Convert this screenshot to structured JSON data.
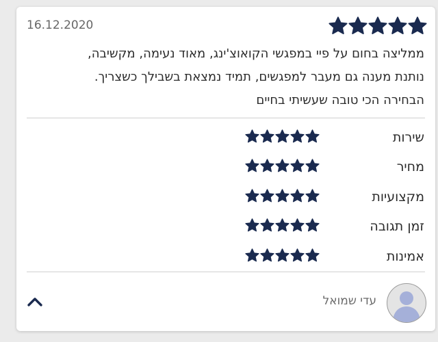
{
  "review": {
    "date": "16.12.2020",
    "overall_rating": 5,
    "overall_max": 5,
    "text_lines": [
      "ממליצה בחום על פיי במפגשי הקואוצ'ינג, מאוד נעימה, מקשיבה,",
      "נותנת מענה גם מעבר למפגשים, תמיד נמצאת בשבילך כשצריך.",
      "הבחירה הכי טובה שעשיתי בחיים"
    ],
    "categories": [
      {
        "label": "שירות",
        "rating": 5,
        "max": 5
      },
      {
        "label": "מחיר",
        "rating": 5,
        "max": 5
      },
      {
        "label": "מקצועיות",
        "rating": 5,
        "max": 5
      },
      {
        "label": "זמן תגובה",
        "rating": 5,
        "max": 5
      },
      {
        "label": "אמינות",
        "rating": 5,
        "max": 5
      }
    ],
    "author": {
      "name": "עדי שמואל",
      "avatar_icon": "default-user-avatar-icon"
    },
    "collapse_icon": "chevron-up-icon"
  },
  "colors": {
    "star": "#1a2a4f",
    "chevron": "#1a2a4f",
    "avatar_figure": "#a5b0d9"
  }
}
